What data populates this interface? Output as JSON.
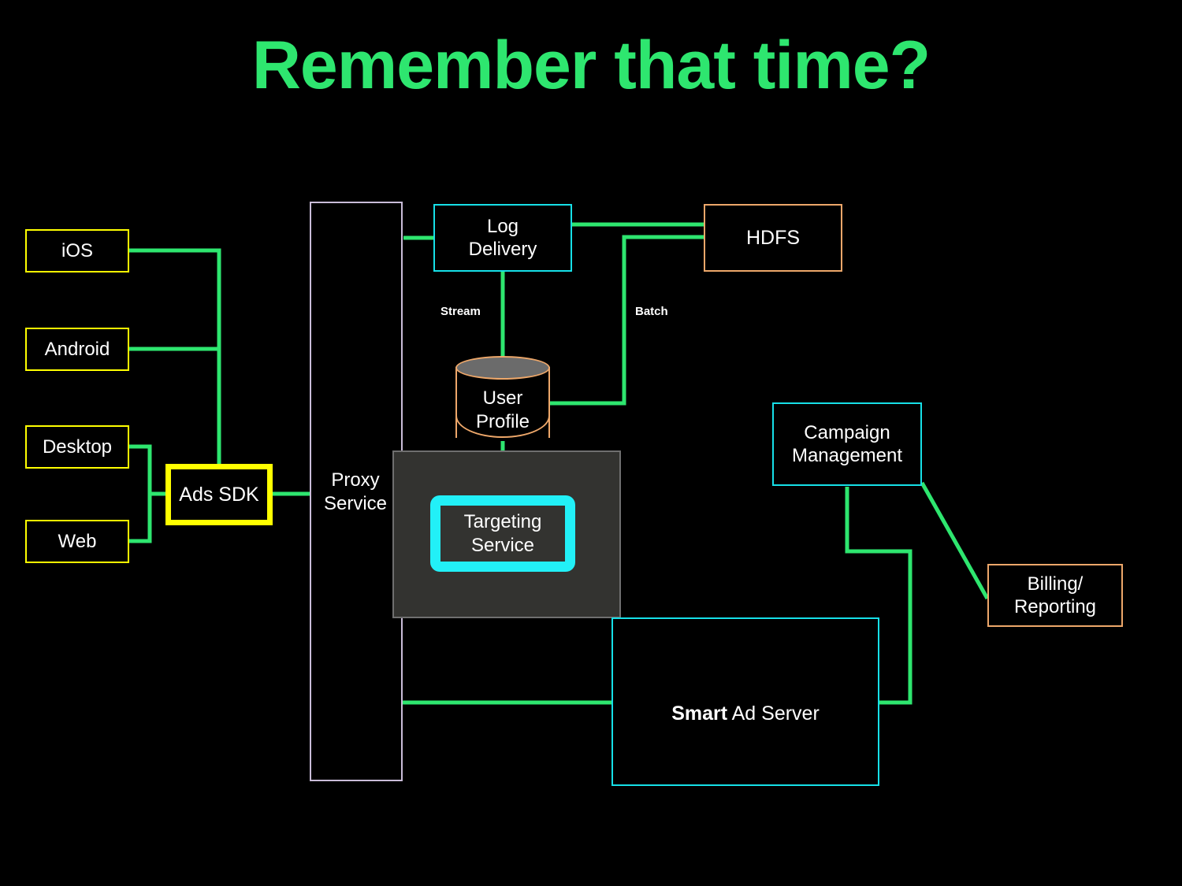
{
  "slide": {
    "title": "Remember that time?",
    "title_color": "#2ee66f",
    "background_color": "#000000"
  },
  "clients": [
    {
      "id": "ios",
      "label": "iOS",
      "border_color": "#ffff00"
    },
    {
      "id": "android",
      "label": "Android",
      "border_color": "#ffff00"
    },
    {
      "id": "desktop",
      "label": "Desktop",
      "border_color": "#ffff00"
    },
    {
      "id": "web",
      "label": "Web",
      "border_color": "#ffff00"
    }
  ],
  "nodes": {
    "ads_sdk": {
      "label": "Ads SDK",
      "border_color": "#ffff00"
    },
    "proxy": {
      "label": "Proxy\nService",
      "border_color": "#c9bcd8"
    },
    "log": {
      "label": "Log\nDelivery",
      "border_color": "#16e0e8"
    },
    "hdfs": {
      "label": "HDFS",
      "border_color": "#eda76a"
    },
    "profile": {
      "label": "User\nProfile",
      "border_color": "#eda76a"
    },
    "targeting": {
      "label": "Targeting\nService",
      "border_color": "#22f0f7"
    },
    "campaign": {
      "label": "Campaign\nManagement",
      "border_color": "#16e0e8"
    },
    "billing": {
      "label": "Billing/\nReporting",
      "border_color": "#eda76a"
    },
    "ad_server": {
      "label_strong": "Smart",
      "label_rest": " Ad Server",
      "border_color": "#16e0e8"
    }
  },
  "edge_labels": {
    "stream": "Stream",
    "batch": "Batch"
  },
  "colors": {
    "wire": "#2ee66f",
    "panel_fill": "#333330",
    "panel_border": "#6f6f6f",
    "cylinder_top_fill": "#6b6b6b",
    "text": "#ffffff"
  }
}
